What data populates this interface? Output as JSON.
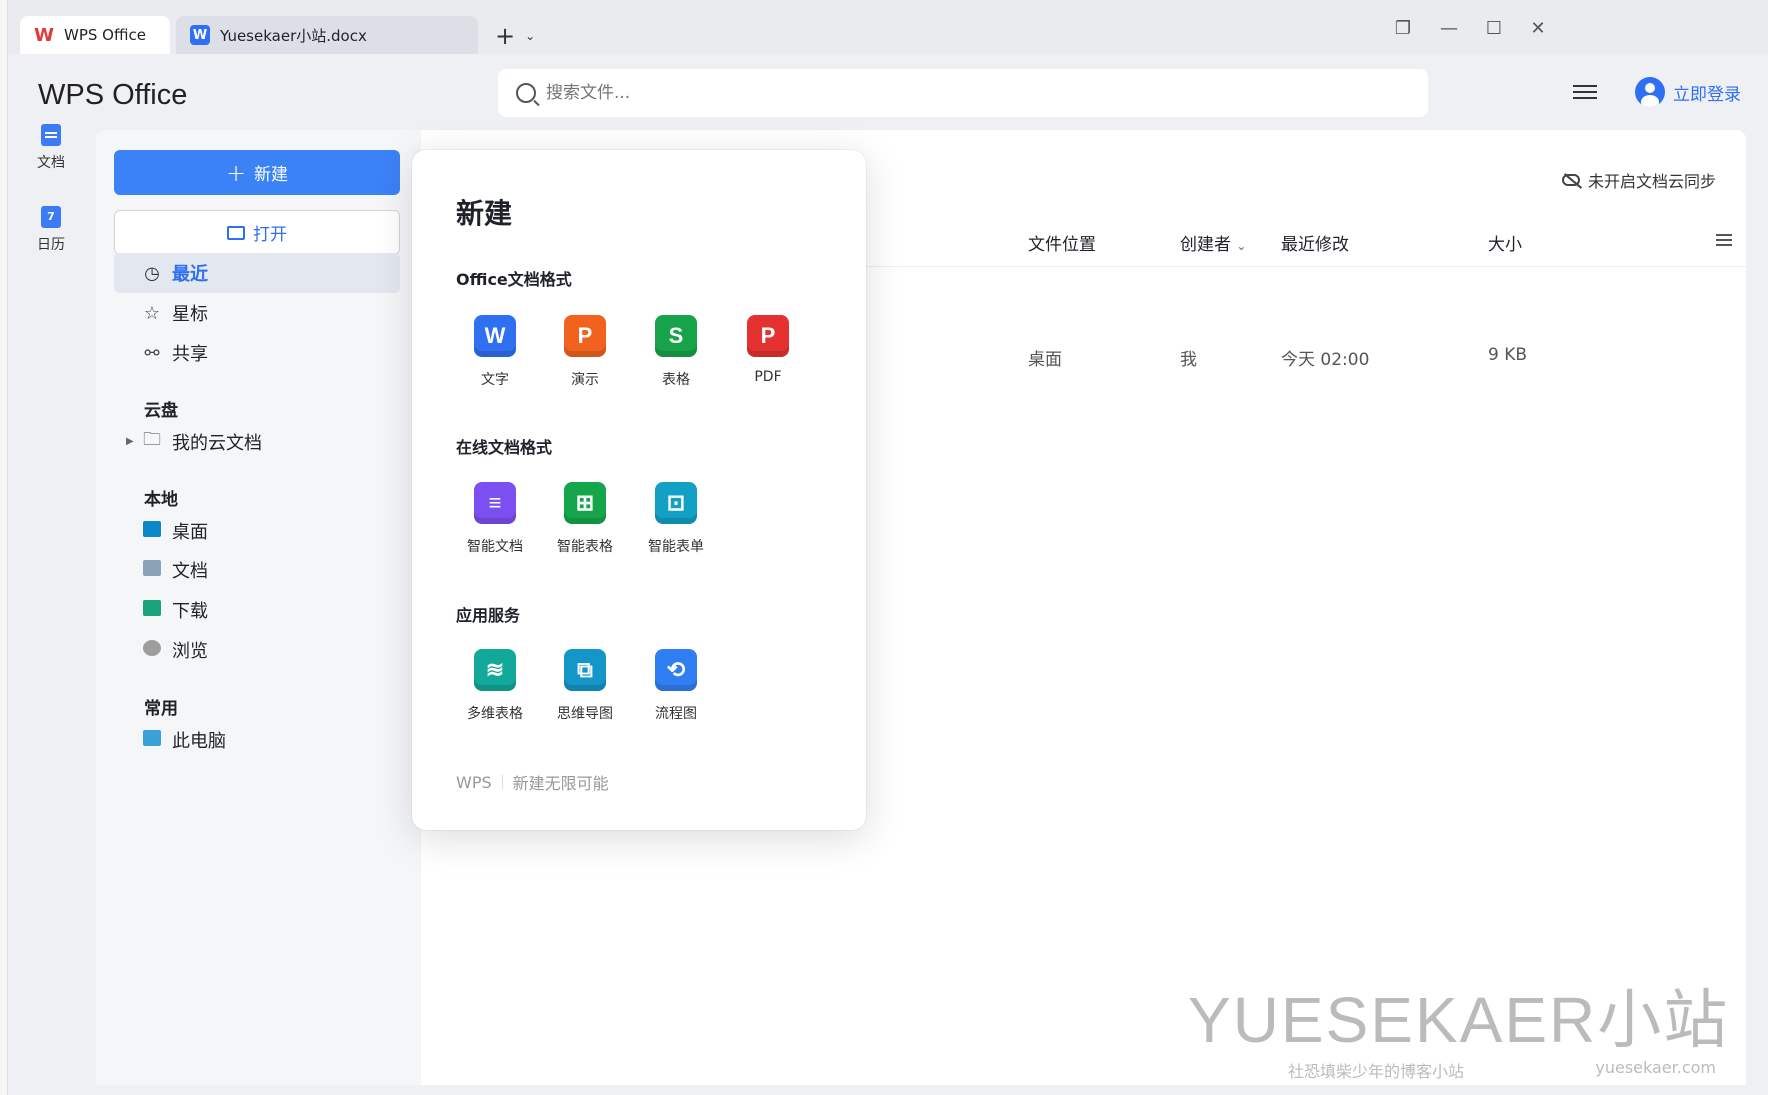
{
  "tabs": [
    {
      "label": "WPS Office",
      "icon": "wps-logo-icon"
    },
    {
      "label": "Yuesekaer小站.docx",
      "icon": "word-doc-icon"
    }
  ],
  "header": {
    "brand": "WPS Office",
    "search_placeholder": "搜索文件...",
    "login_label": "立即登录"
  },
  "rail": [
    {
      "label": "文档",
      "icon": "document-icon"
    },
    {
      "label": "日历",
      "icon": "calendar-icon",
      "badge": "7"
    }
  ],
  "sidebar": {
    "new_label": "新建",
    "open_label": "打开",
    "nav": [
      {
        "label": "最近",
        "icon": "clock-icon",
        "active": true
      },
      {
        "label": "星标",
        "icon": "star-icon"
      },
      {
        "label": "共享",
        "icon": "share-icon"
      }
    ],
    "sections": {
      "cloud": "云盘",
      "local": "本地",
      "common": "常用"
    },
    "cloud_items": [
      {
        "label": "我的云文档"
      }
    ],
    "local_items": [
      {
        "label": "桌面",
        "color": "#0a86c9"
      },
      {
        "label": "文档",
        "color": "#8aa3b8"
      },
      {
        "label": "下载",
        "color": "#1aa37a"
      },
      {
        "label": "浏览",
        "color": "#9e9e9e"
      }
    ],
    "common_items": [
      {
        "label": "此电脑"
      }
    ]
  },
  "main": {
    "sync_label": "未开启文档云同步",
    "columns": [
      "文件位置",
      "创建者",
      "最近修改",
      "大小"
    ],
    "rows": [
      {
        "location": "桌面",
        "creator": "我",
        "modified": "今天 02:00",
        "size": "9 KB"
      }
    ]
  },
  "popup": {
    "title": "新建",
    "groups": [
      {
        "title": "Office文档格式",
        "apps": [
          {
            "label": "文字",
            "glyph": "W",
            "color": "#2f6ff2"
          },
          {
            "label": "演示",
            "glyph": "P",
            "color": "#f0621e"
          },
          {
            "label": "表格",
            "glyph": "S",
            "color": "#17a34a"
          },
          {
            "label": "PDF",
            "glyph": "P",
            "color": "#e5312f"
          }
        ]
      },
      {
        "title": "在线文档格式",
        "apps": [
          {
            "label": "智能文档",
            "glyph": "≡",
            "color": "#7b4ff0"
          },
          {
            "label": "智能表格",
            "glyph": "⊞",
            "color": "#15a64b"
          },
          {
            "label": "智能表单",
            "glyph": "⊡",
            "color": "#12a0c4"
          }
        ]
      },
      {
        "title": "应用服务",
        "apps": [
          {
            "label": "多维表格",
            "glyph": "≋",
            "color": "#12a89a"
          },
          {
            "label": "思维导图",
            "glyph": "⧉",
            "color": "#1496c8"
          },
          {
            "label": "流程图",
            "glyph": "⟲",
            "color": "#2f7ff2"
          }
        ]
      }
    ],
    "footer_brand": "WPS",
    "footer_slogan": "新建无限可能"
  },
  "watermark": {
    "main": "YUESEKAER小站",
    "sub": "社恐填柴少年的博客小站",
    "url": "yuesekaer.com"
  }
}
